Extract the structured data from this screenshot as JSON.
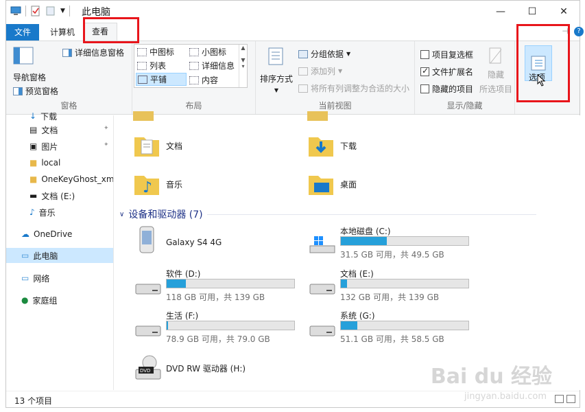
{
  "window": {
    "title": "此电脑"
  },
  "tabs": [
    {
      "label": "文件"
    },
    {
      "label": "计算机"
    },
    {
      "label": "查看"
    }
  ],
  "ribbon": {
    "panes": {
      "nav_pane": "导航窗格",
      "preview_pane": "预览窗格",
      "details_pane": "详细信息窗格",
      "group": "窗格"
    },
    "layout": {
      "medium_icons": "中图标",
      "small_icons": "小图标",
      "list": "列表",
      "details": "详细信息",
      "tiles": "平铺",
      "content": "内容",
      "group": "布局"
    },
    "current_view": {
      "sort_by": "排序方式",
      "group_by": "分组依据",
      "add_columns": "添加列",
      "fit_columns": "将所有列调整为合适的大小",
      "group": "当前视图"
    },
    "show_hide": {
      "item_checkboxes": "项目复选框",
      "file_extensions": "文件扩展名",
      "hidden_items": "隐藏的项目",
      "hide": "隐藏",
      "hide_selected": "所选项目",
      "group": "显示/隐藏",
      "item_checkboxes_checked": false,
      "file_extensions_checked": true,
      "hidden_items_checked": false
    },
    "options": {
      "label": "选项"
    }
  },
  "nav": {
    "items": [
      {
        "label": "下载"
      },
      {
        "label": "文档"
      },
      {
        "label": "图片"
      },
      {
        "label": "local"
      },
      {
        "label": "OneKeyGhost_xme"
      },
      {
        "label": "文档 (E:)"
      },
      {
        "label": "音乐"
      },
      {
        "label": "OneDrive"
      },
      {
        "label": "此电脑"
      },
      {
        "label": "网络"
      },
      {
        "label": "家庭组"
      }
    ]
  },
  "folders": [
    {
      "label": "文档"
    },
    {
      "label": "下载"
    },
    {
      "label": "音乐"
    },
    {
      "label": "桌面"
    }
  ],
  "devices": {
    "header": "设备和驱动器 (7)",
    "items": [
      {
        "name": "Galaxy S4 4G"
      },
      {
        "name": "本地磁盘 (C:)",
        "free": "31.5 GB 可用，共 49.5 GB",
        "used_fraction": 0.36
      },
      {
        "name": "软件 (D:)",
        "free": "118 GB 可用，共 139 GB",
        "used_fraction": 0.15
      },
      {
        "name": "文档 (E:)",
        "free": "132 GB 可用，共 139 GB",
        "used_fraction": 0.05
      },
      {
        "name": "生活 (F:)",
        "free": "78.9 GB 可用，共 79.0 GB",
        "used_fraction": 0.01
      },
      {
        "name": "系统 (G:)",
        "free": "51.1 GB 可用，共 58.5 GB",
        "used_fraction": 0.13
      },
      {
        "name": "DVD RW 驱动器 (H:)"
      }
    ]
  },
  "status": {
    "count": "13 个项目"
  },
  "colors": {
    "accent": "#1979ca",
    "bar": "#26a0da",
    "highlight": "#e8151b"
  }
}
